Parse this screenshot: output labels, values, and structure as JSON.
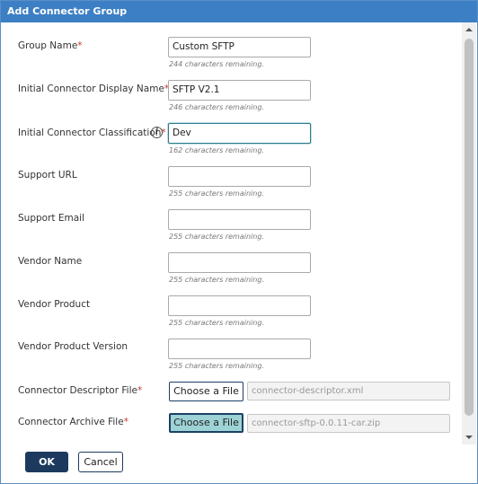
{
  "dialog": {
    "title": "Add Connector Group"
  },
  "fields": [
    {
      "label": "Group Name",
      "required": "*",
      "value": "Custom SFTP",
      "hint": "244 characters remaining."
    },
    {
      "label": "Initial Connector Display Name",
      "required": "*",
      "value": "SFTP V2.1",
      "hint": "246 characters remaining."
    },
    {
      "label": "Initial Connector Classification",
      "required": "*",
      "value": "Dev",
      "hint": "162 characters remaining."
    },
    {
      "label": "Support URL",
      "required": "",
      "value": "",
      "hint": "255 characters remaining."
    },
    {
      "label": "Support Email",
      "required": "",
      "value": "",
      "hint": "255 characters remaining."
    },
    {
      "label": "Vendor Name",
      "required": "",
      "value": "",
      "hint": "255 characters remaining."
    },
    {
      "label": "Vendor Product",
      "required": "",
      "value": "",
      "hint": "255 characters remaining."
    },
    {
      "label": "Vendor Product Version",
      "required": "",
      "value": "",
      "hint": "255 characters remaining."
    }
  ],
  "info_icon": {
    "icon": "info-icon",
    "glyph": "i"
  },
  "files": [
    {
      "label": "Connector Descriptor File",
      "required": "*",
      "button_label": "Choose a File",
      "file_name": "connector-descriptor.xml"
    },
    {
      "label": "Connector Archive File",
      "required": "*",
      "button_label": "Choose a File",
      "file_name": "connector-sftp-0.0.11-car.zip"
    }
  ],
  "footer": {
    "ok_label": "OK",
    "cancel_label": "Cancel"
  },
  "colors": {
    "titlebar": "#3c7fc4",
    "required": "#c0392b",
    "primary_button": "#1d3a5e",
    "active_file_button": "#9ed3d6",
    "focus_border": "#2d7a8c"
  }
}
